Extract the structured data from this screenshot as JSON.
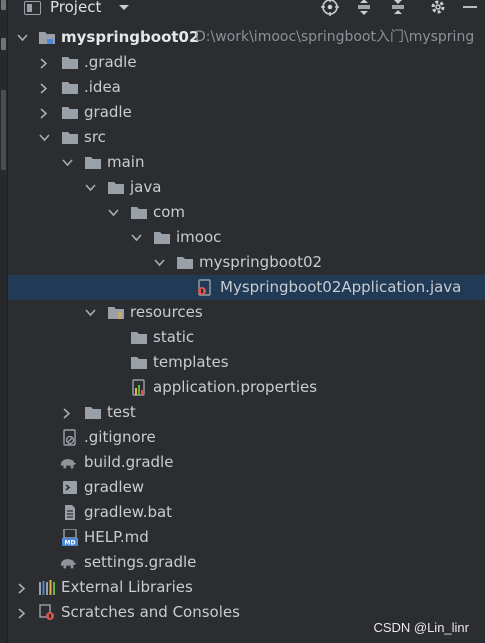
{
  "header": {
    "title": "Project",
    "dropdown_icon": "chevron-down-icon",
    "toolbar": [
      "locate-icon",
      "expand-all-icon",
      "collapse-all-icon",
      "settings-icon",
      "hide-icon"
    ]
  },
  "tree": {
    "root": {
      "name": "myspringboot02",
      "path": "D:\\work\\imooc\\springboot入门\\myspring"
    },
    "items": [
      {
        "name": ".gradle",
        "type": "folder",
        "expanded": false
      },
      {
        "name": ".idea",
        "type": "folder",
        "expanded": false
      },
      {
        "name": "gradle",
        "type": "folder",
        "expanded": false
      },
      {
        "name": "src",
        "type": "folder",
        "expanded": true
      },
      {
        "name": "main",
        "type": "folder",
        "expanded": true
      },
      {
        "name": "java",
        "type": "source-folder",
        "expanded": true
      },
      {
        "name": "com",
        "type": "package",
        "expanded": true
      },
      {
        "name": "imooc",
        "type": "package",
        "expanded": true
      },
      {
        "name": "myspringboot02",
        "type": "package",
        "expanded": true
      },
      {
        "name": "Myspringboot02Application.java",
        "type": "java-class",
        "selected": true
      },
      {
        "name": "resources",
        "type": "resource-folder",
        "expanded": true
      },
      {
        "name": "static",
        "type": "folder"
      },
      {
        "name": "templates",
        "type": "folder"
      },
      {
        "name": "application.properties",
        "type": "properties-file"
      },
      {
        "name": "test",
        "type": "folder",
        "expanded": false
      },
      {
        "name": ".gitignore",
        "type": "gitignore-file"
      },
      {
        "name": "build.gradle",
        "type": "gradle-file"
      },
      {
        "name": "gradlew",
        "type": "shell-file"
      },
      {
        "name": "gradlew.bat",
        "type": "text-file"
      },
      {
        "name": "HELP.md",
        "type": "markdown-file"
      },
      {
        "name": "settings.gradle",
        "type": "gradle-file"
      },
      {
        "name": "External Libraries",
        "type": "libraries",
        "expanded": false
      },
      {
        "name": "Scratches and Consoles",
        "type": "scratches",
        "expanded": false
      }
    ]
  },
  "watermark": "CSDN @Lin_linr",
  "colors": {
    "background": "#2b2d30",
    "selection": "#213a55",
    "folder": "#9aa0a8",
    "text": "#c9ccd1"
  }
}
